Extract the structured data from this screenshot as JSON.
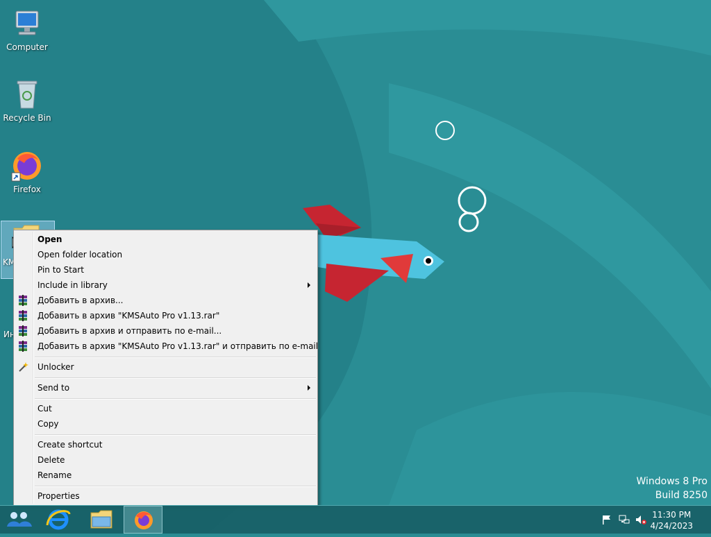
{
  "desktop": {
    "icons": [
      {
        "label": "Computer",
        "icon": "computer-icon"
      },
      {
        "label": "Recycle Bin",
        "icon": "recycle-bin-icon"
      },
      {
        "label": "Firefox",
        "icon": "firefox-icon"
      }
    ],
    "partial_labels": {
      "selected_item": "KM",
      "below_item": "Ин"
    }
  },
  "context_menu": {
    "open": "Open",
    "open_folder_location": "Open folder location",
    "pin_to_start": "Pin to Start",
    "include_in_library": "Include in library",
    "rar_add": "Добавить в архив...",
    "rar_add_named": "Добавить в архив \"KMSAuto Pro v1.13.rar\"",
    "rar_add_email": "Добавить в архив и отправить по e-mail...",
    "rar_add_named_email": "Добавить в архив \"KMSAuto Pro v1.13.rar\" и отправить по e-mail",
    "unlocker": "Unlocker",
    "send_to": "Send to",
    "cut": "Cut",
    "copy": "Copy",
    "create_shortcut": "Create shortcut",
    "delete": "Delete",
    "rename": "Rename",
    "properties": "Properties"
  },
  "watermark": {
    "line1": "Windows 8 Pro",
    "line2": "Build 8250"
  },
  "clock": {
    "time": "11:30 PM",
    "date": "4/24/2023"
  },
  "colors": {
    "wallpaper": "#2a8c93",
    "menu_bg": "#f0f0f0"
  }
}
